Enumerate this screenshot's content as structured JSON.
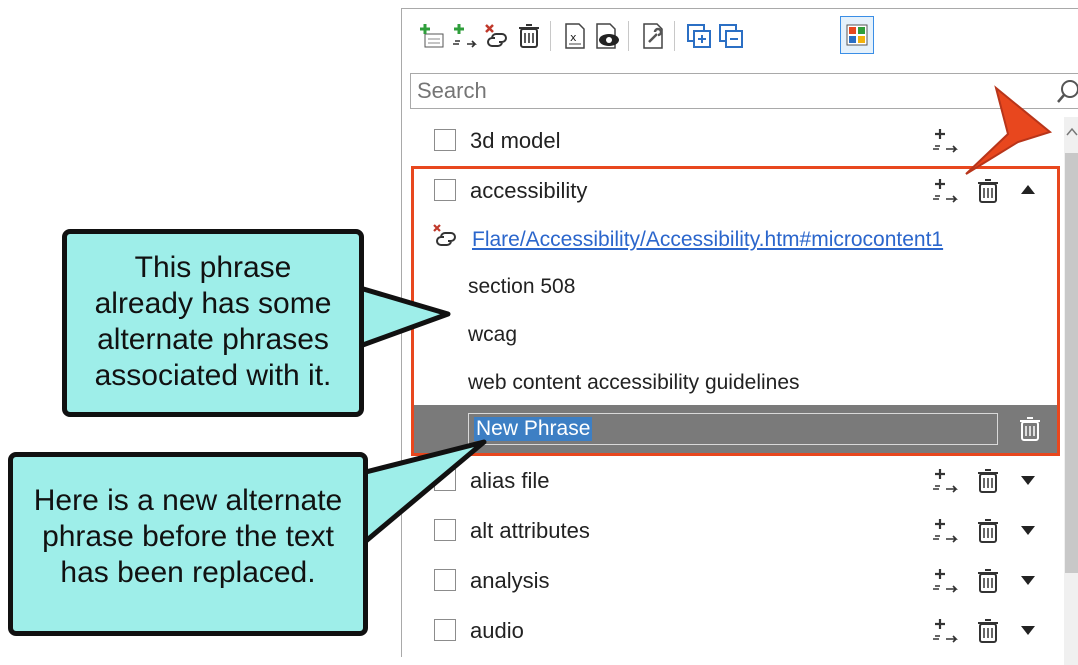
{
  "toolbar": {
    "buttons": [
      "add-phrase",
      "add-alternate",
      "unlink",
      "delete",
      "excel",
      "preview",
      "properties",
      "expand-all",
      "collapse-all",
      "grid-view"
    ]
  },
  "search": {
    "placeholder": "Search"
  },
  "phrases": [
    {
      "label": "3d model",
      "expanded": false
    },
    {
      "label": "accessibility",
      "expanded": true
    },
    {
      "label": "alias file",
      "expanded": false
    },
    {
      "label": "alt attributes",
      "expanded": false
    },
    {
      "label": "analysis",
      "expanded": false
    },
    {
      "label": "audio",
      "expanded": false
    }
  ],
  "accessibility_details": {
    "link": "Flare/Accessibility/Accessibility.htm#microcontent1",
    "alternates": [
      "section 508",
      "wcag",
      "web content accessibility guidelines"
    ],
    "new_phrase": "New Phrase"
  },
  "callouts": {
    "top": [
      "This phrase",
      "already has some",
      "alternate phrases",
      "associated with it."
    ],
    "bottom": [
      "Here is a new alternate",
      "phrase before the text",
      "has been replaced."
    ]
  },
  "colors": {
    "highlight": "#e8471e",
    "callout_fill": "#9eeee9",
    "link": "#2b66cc",
    "selection": "#3d7fc4"
  }
}
